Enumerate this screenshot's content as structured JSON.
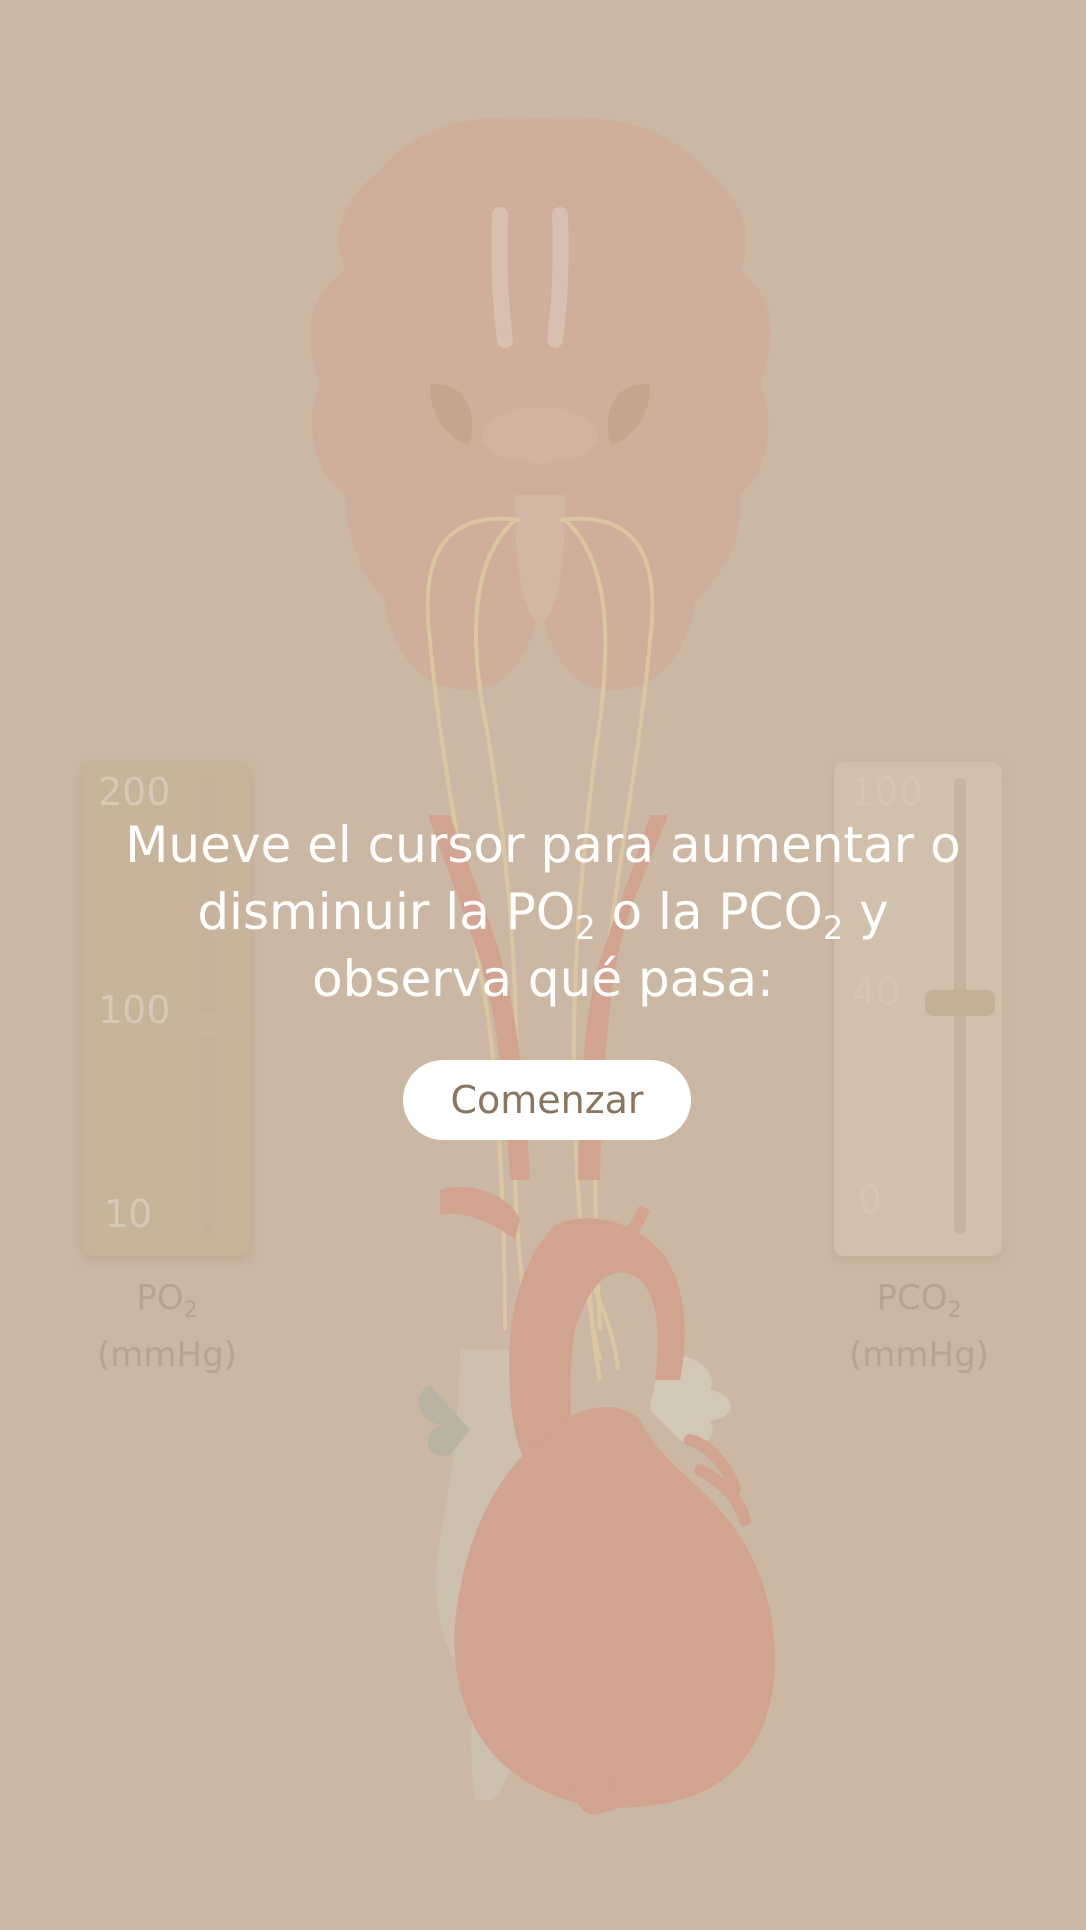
{
  "overlay": {
    "line1": "Mueve el cursor para aumentar o",
    "line2_a": "disminuir la PO",
    "sub_a": "2",
    "line2_b": " o la PCO",
    "sub_b": "2",
    "line2_c": " y",
    "line3": "observa qué pasa:",
    "button_label": "Comenzar"
  },
  "po2_slider": {
    "tick_top": "200",
    "tick_mid": "100",
    "tick_bottom": "10",
    "caption_main": "PO",
    "caption_sub": "2",
    "caption_unit": "(mmHg)",
    "value": 100
  },
  "pco2_slider": {
    "tick_top": "100",
    "tick_mid": "40",
    "tick_bottom": "0",
    "caption_main": "PCO",
    "caption_sub": "2",
    "caption_unit": "(mmHg)",
    "value": 40
  },
  "colors": {
    "background": "#cbb8a4",
    "brain": "#cfae9c",
    "artery": "#d2a391",
    "nerve": "#dcc6a2",
    "vein": "#cdc0ae",
    "button_text": "#8a7561"
  },
  "illustration_icons": [
    "brain-icon",
    "heart-icon",
    "aorta-icon",
    "carotid-artery-icon",
    "nerve-icon"
  ]
}
